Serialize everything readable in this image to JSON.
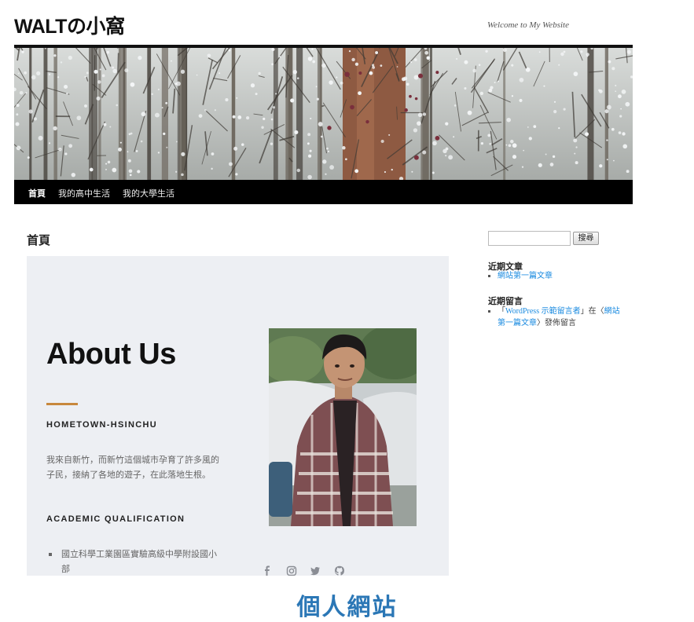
{
  "site": {
    "title": "WALTの小窩",
    "description": "Welcome to My Website"
  },
  "nav": {
    "items": [
      {
        "label": "首頁"
      },
      {
        "label": "我的高中生活"
      },
      {
        "label": "我的大學生活"
      }
    ]
  },
  "page": {
    "heading": "首頁"
  },
  "about": {
    "title": "About Us",
    "hometown_heading": "HOMETOWN-HSINCHU",
    "hometown_text": "我來自新竹，而新竹這個城市孕育了許多風的子民，接納了各地的遊子，在此落地生根。",
    "academic_heading": "ACADEMIC QUALIFICATION",
    "academic_items": [
      "國立科學工業園區實驗高級中學附設國小部"
    ],
    "social_icons": [
      "facebook-icon",
      "instagram-icon",
      "twitter-icon",
      "github-icon"
    ]
  },
  "sidebar": {
    "search_placeholder": "",
    "search_button": "搜尋",
    "recent_posts_title": "近期文章",
    "recent_posts": [
      "網站第一篇文章"
    ],
    "recent_comments_title": "近期留言",
    "recent_comment": {
      "open_quote": "「",
      "author": "WordPress 示範留言者",
      "middle": "」在〈",
      "post": "網站第一篇文章",
      "end": "〉發佈留言"
    }
  },
  "caption": "個人網站",
  "colors": {
    "accent": "#c8883d",
    "link": "#1b8be0",
    "caption": "#2b77b6",
    "nav_bg": "#000000"
  }
}
